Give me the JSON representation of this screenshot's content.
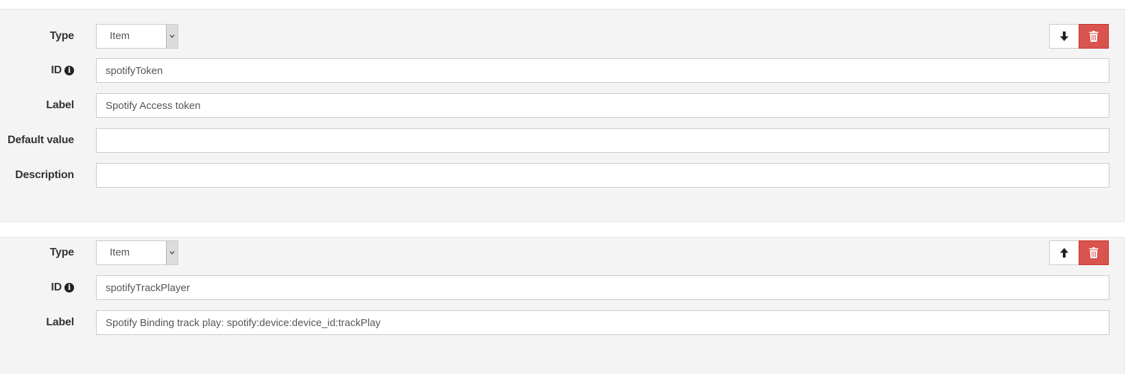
{
  "colors": {
    "panel_bg": "#f4f4f4",
    "delete_button": "#d9534f",
    "input_border": "#c9c9c9"
  },
  "panels": [
    {
      "type_label": "Type",
      "type_value": "Item",
      "move_icon": "arrow-down-icon",
      "delete_icon": "trash-icon",
      "id_label": "ID",
      "id_info_icon": "info-icon",
      "id_value": "spotifyToken",
      "label_label": "Label",
      "label_value": "Spotify Access token",
      "default_label": "Default value",
      "default_value": "",
      "description_label": "Description",
      "description_value": ""
    },
    {
      "type_label": "Type",
      "type_value": "Item",
      "move_icon": "arrow-up-icon",
      "delete_icon": "trash-icon",
      "id_label": "ID",
      "id_info_icon": "info-icon",
      "id_value": "spotifyTrackPlayer",
      "label_label": "Label",
      "label_value": "Spotify Binding track play: spotify:device:device_id:trackPlay"
    }
  ]
}
